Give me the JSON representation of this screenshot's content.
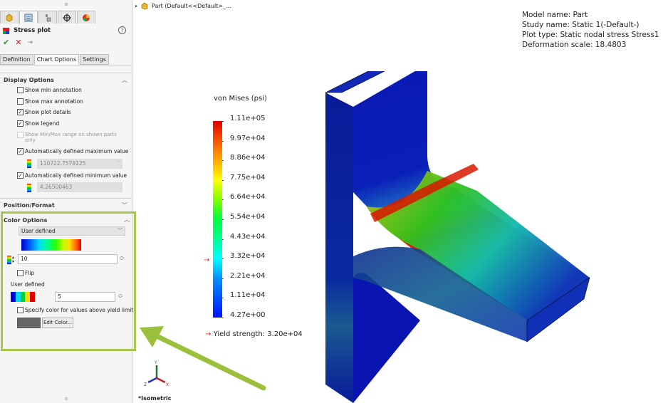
{
  "property_manager": {
    "top_tabs": [
      {
        "icon": "feature-manager-icon",
        "active": false
      },
      {
        "icon": "property-manager-icon",
        "active": true
      },
      {
        "icon": "configuration-manager-icon",
        "active": false
      },
      {
        "icon": "dimxpert-icon",
        "active": false
      },
      {
        "icon": "display-manager-icon",
        "active": false
      }
    ],
    "title": "Stress plot",
    "help_label": "?",
    "actions": {
      "ok": "✔",
      "cancel": "✕",
      "pin": "⇥"
    },
    "sub_tabs": [
      {
        "label": "Definition",
        "active": false
      },
      {
        "label": "Chart Options",
        "active": true
      },
      {
        "label": "Settings",
        "active": false
      }
    ],
    "display_options": {
      "title": "Display Options",
      "checkboxes": [
        {
          "label": "Show min annotation",
          "checked": false,
          "enabled": true
        },
        {
          "label": "Show max annotation",
          "checked": false,
          "enabled": true
        },
        {
          "label": "Show plot details",
          "checked": true,
          "enabled": true
        },
        {
          "label": "Show legend",
          "checked": true,
          "enabled": true
        },
        {
          "label": "Show Min/Max range on shown parts only",
          "checked": false,
          "enabled": false
        },
        {
          "label": "Automatically defined maximum value",
          "checked": true,
          "enabled": true
        },
        {
          "label": "Automatically defined minimum value",
          "checked": true,
          "enabled": true
        }
      ],
      "max_value": "110722.7578125",
      "min_value": "4.26500463"
    },
    "position_format": {
      "title": "Position/Format"
    },
    "color_options": {
      "title": "Color Options",
      "scheme": "User defined",
      "num_colors": "10",
      "flip_label": "Flip",
      "flip_checked": false,
      "user_defined_label": "User defined",
      "user_defined_count": "5",
      "user_defined_colors": [
        "#0000e0",
        "#00d8f0",
        "#00d040",
        "#f0e000",
        "#e00000"
      ],
      "yield_color_label": "Specify color for values above yield limit",
      "yield_color_checked": false,
      "yield_color": "#666666",
      "edit_color_label": "Edit Color..."
    }
  },
  "tree": {
    "label": "Part  (Default<<Default>_..."
  },
  "plot_details": {
    "model_name": "Model name: Part",
    "study_name": "Study name: Static 1(-Default-)",
    "plot_type": "Plot type: Static nodal stress Stress1",
    "deformation_scale": "Deformation scale: 18.4803"
  },
  "legend": {
    "title": "von Mises (psi)",
    "labels": [
      "1.11e+05",
      "9.97e+04",
      "8.86e+04",
      "7.75e+04",
      "6.64e+04",
      "5.54e+04",
      "4.43e+04",
      "3.32e+04",
      "2.21e+04",
      "1.11e+04",
      "4.27e+00"
    ],
    "max": 110722.7578125,
    "min": 4.26500463,
    "yield_marker": "→",
    "yield_label": "Yield strength: 3.20e+04",
    "yield_value": 32000
  },
  "view": {
    "orientation": "*Isometric",
    "triad": {
      "x": "X",
      "y": "Y",
      "z": "Z"
    }
  },
  "annotation": {
    "arrow_color": "#9bc13c",
    "highlight_color": "#a7c64a"
  }
}
